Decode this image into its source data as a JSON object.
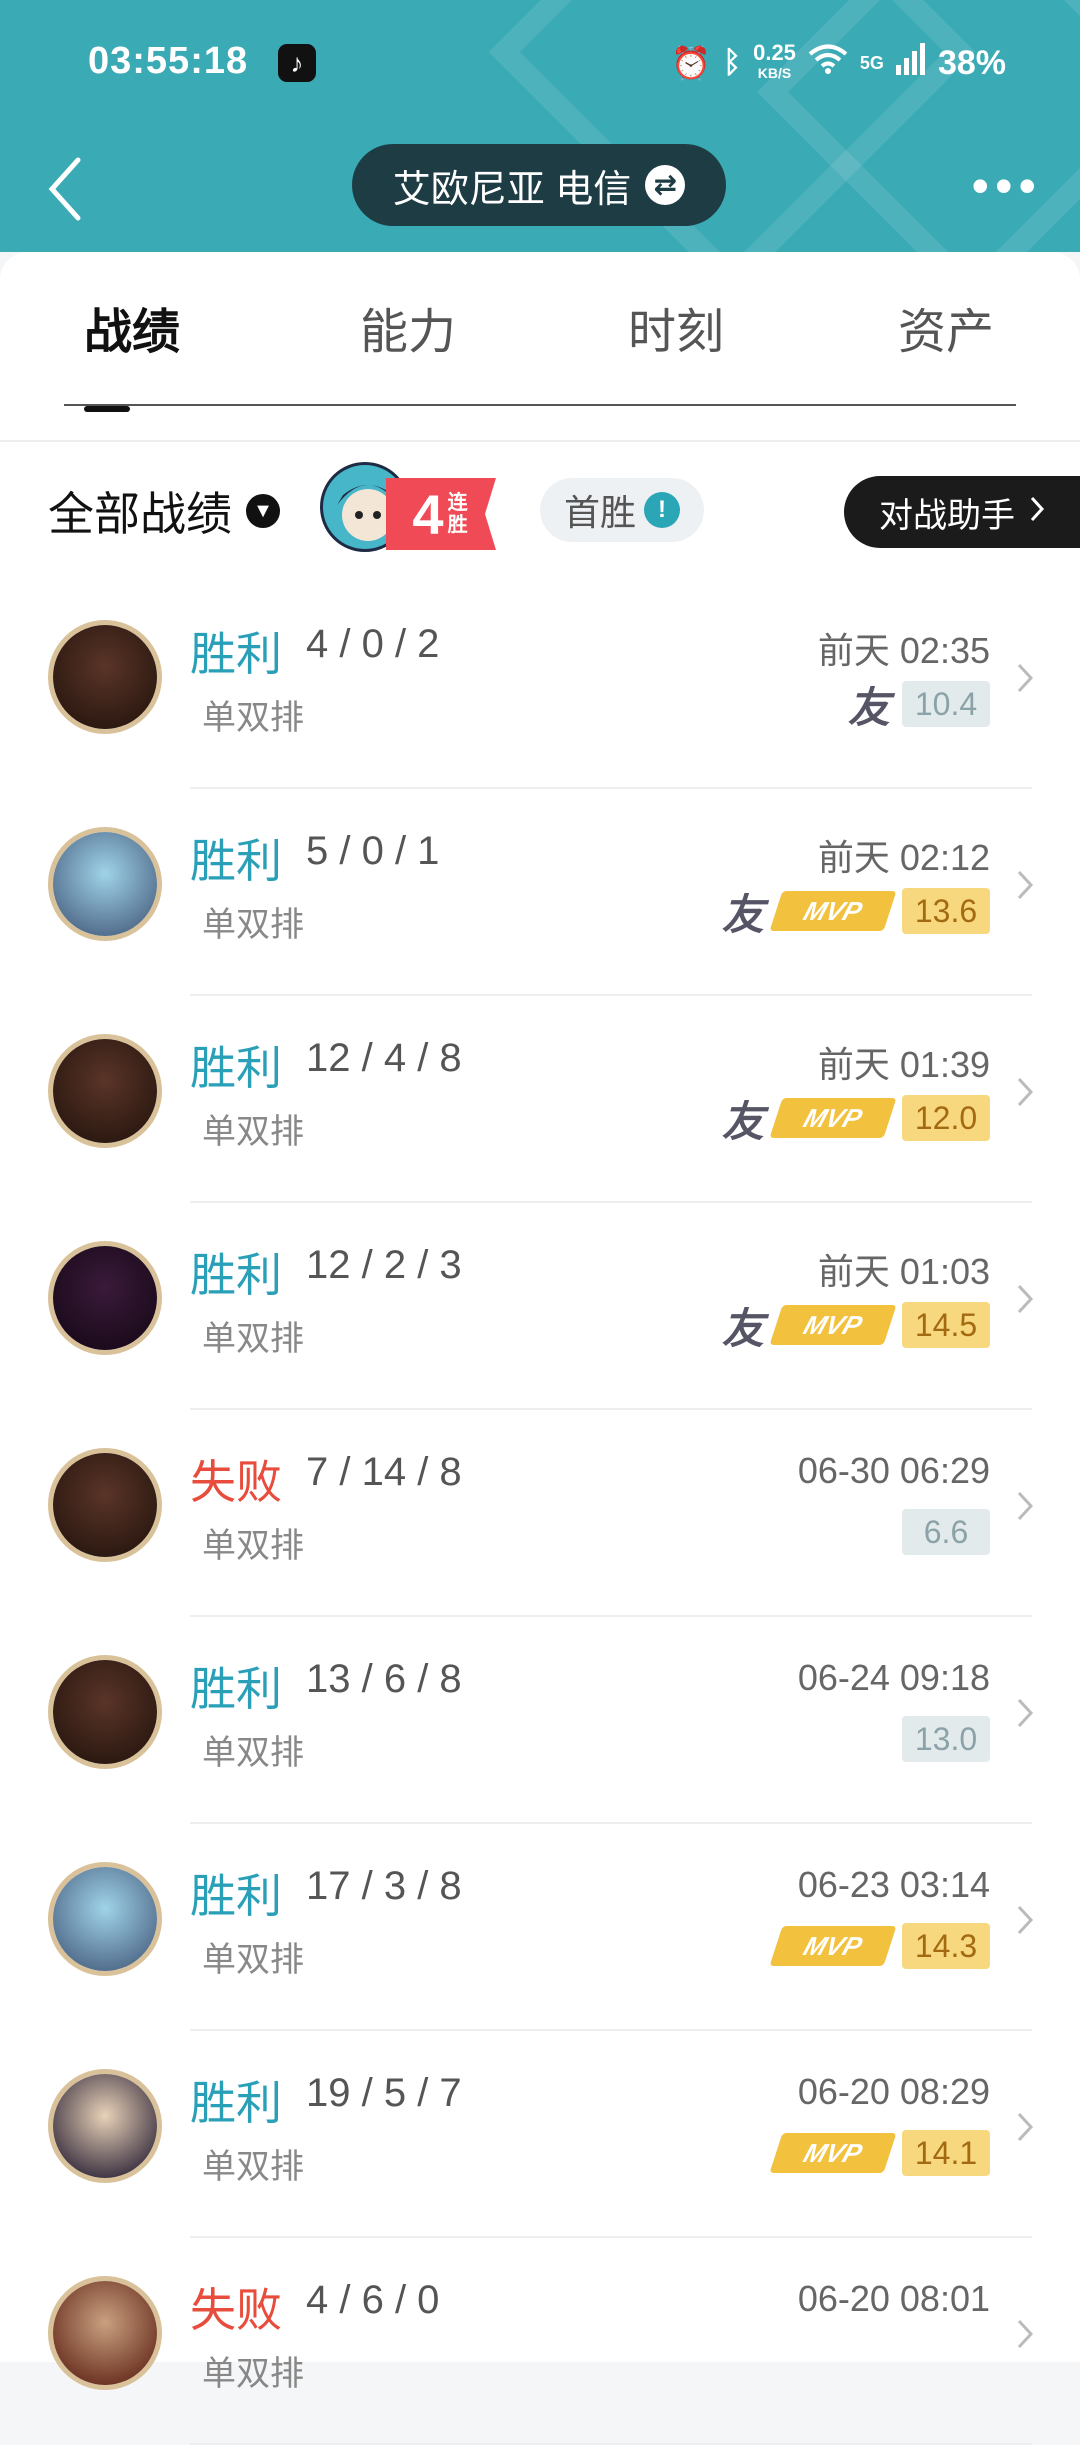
{
  "status": {
    "time": "03:55:18",
    "network_speed_value": "0.25",
    "network_speed_unit": "KB/S",
    "net_type": "5G",
    "battery": "38%"
  },
  "nav": {
    "server": "艾欧尼亚 电信"
  },
  "tabs": [
    {
      "label": "战绩"
    },
    {
      "label": "能力"
    },
    {
      "label": "时刻"
    },
    {
      "label": "资产"
    }
  ],
  "filter": {
    "label": "全部战绩"
  },
  "streak": {
    "count": "4",
    "label": "连胜"
  },
  "first_win": {
    "label": "首胜"
  },
  "assistant": {
    "label": "对战助手"
  },
  "matches": [
    {
      "result": "胜利",
      "kda": "4 / 0 / 2",
      "mode": "单双排",
      "time": "前天 02:35",
      "friend": true,
      "mvp": false,
      "score": "10.4"
    },
    {
      "result": "胜利",
      "kda": "5 / 0 / 1",
      "mode": "单双排",
      "time": "前天 02:12",
      "friend": true,
      "mvp": true,
      "score": "13.6"
    },
    {
      "result": "胜利",
      "kda": "12 / 4 / 8",
      "mode": "单双排",
      "time": "前天 01:39",
      "friend": true,
      "mvp": true,
      "score": "12.0"
    },
    {
      "result": "胜利",
      "kda": "12 / 2 / 3",
      "mode": "单双排",
      "time": "前天 01:03",
      "friend": true,
      "mvp": true,
      "score": "14.5"
    },
    {
      "result": "失败",
      "kda": "7 / 14 / 8",
      "mode": "单双排",
      "time": "06-30 06:29",
      "friend": false,
      "mvp": false,
      "score": "6.6"
    },
    {
      "result": "胜利",
      "kda": "13 / 6 / 8",
      "mode": "单双排",
      "time": "06-24 09:18",
      "friend": false,
      "mvp": false,
      "score": "13.0"
    },
    {
      "result": "胜利",
      "kda": "17 / 3 / 8",
      "mode": "单双排",
      "time": "06-23 03:14",
      "friend": false,
      "mvp": true,
      "score": "14.3"
    },
    {
      "result": "胜利",
      "kda": "19 / 5 / 7",
      "mode": "单双排",
      "time": "06-20 08:29",
      "friend": false,
      "mvp": true,
      "score": "14.1"
    },
    {
      "result": "失败",
      "kda": "4 / 6 / 0",
      "mode": "单双排",
      "time": "06-20 08:01",
      "friend": false,
      "mvp": false,
      "score": ""
    }
  ],
  "labels": {
    "friend": "友",
    "mvp": "MVP"
  },
  "colors": {
    "win": "#2aa0b8",
    "lose": "#e74c3c",
    "header": "#3aaab5"
  }
}
